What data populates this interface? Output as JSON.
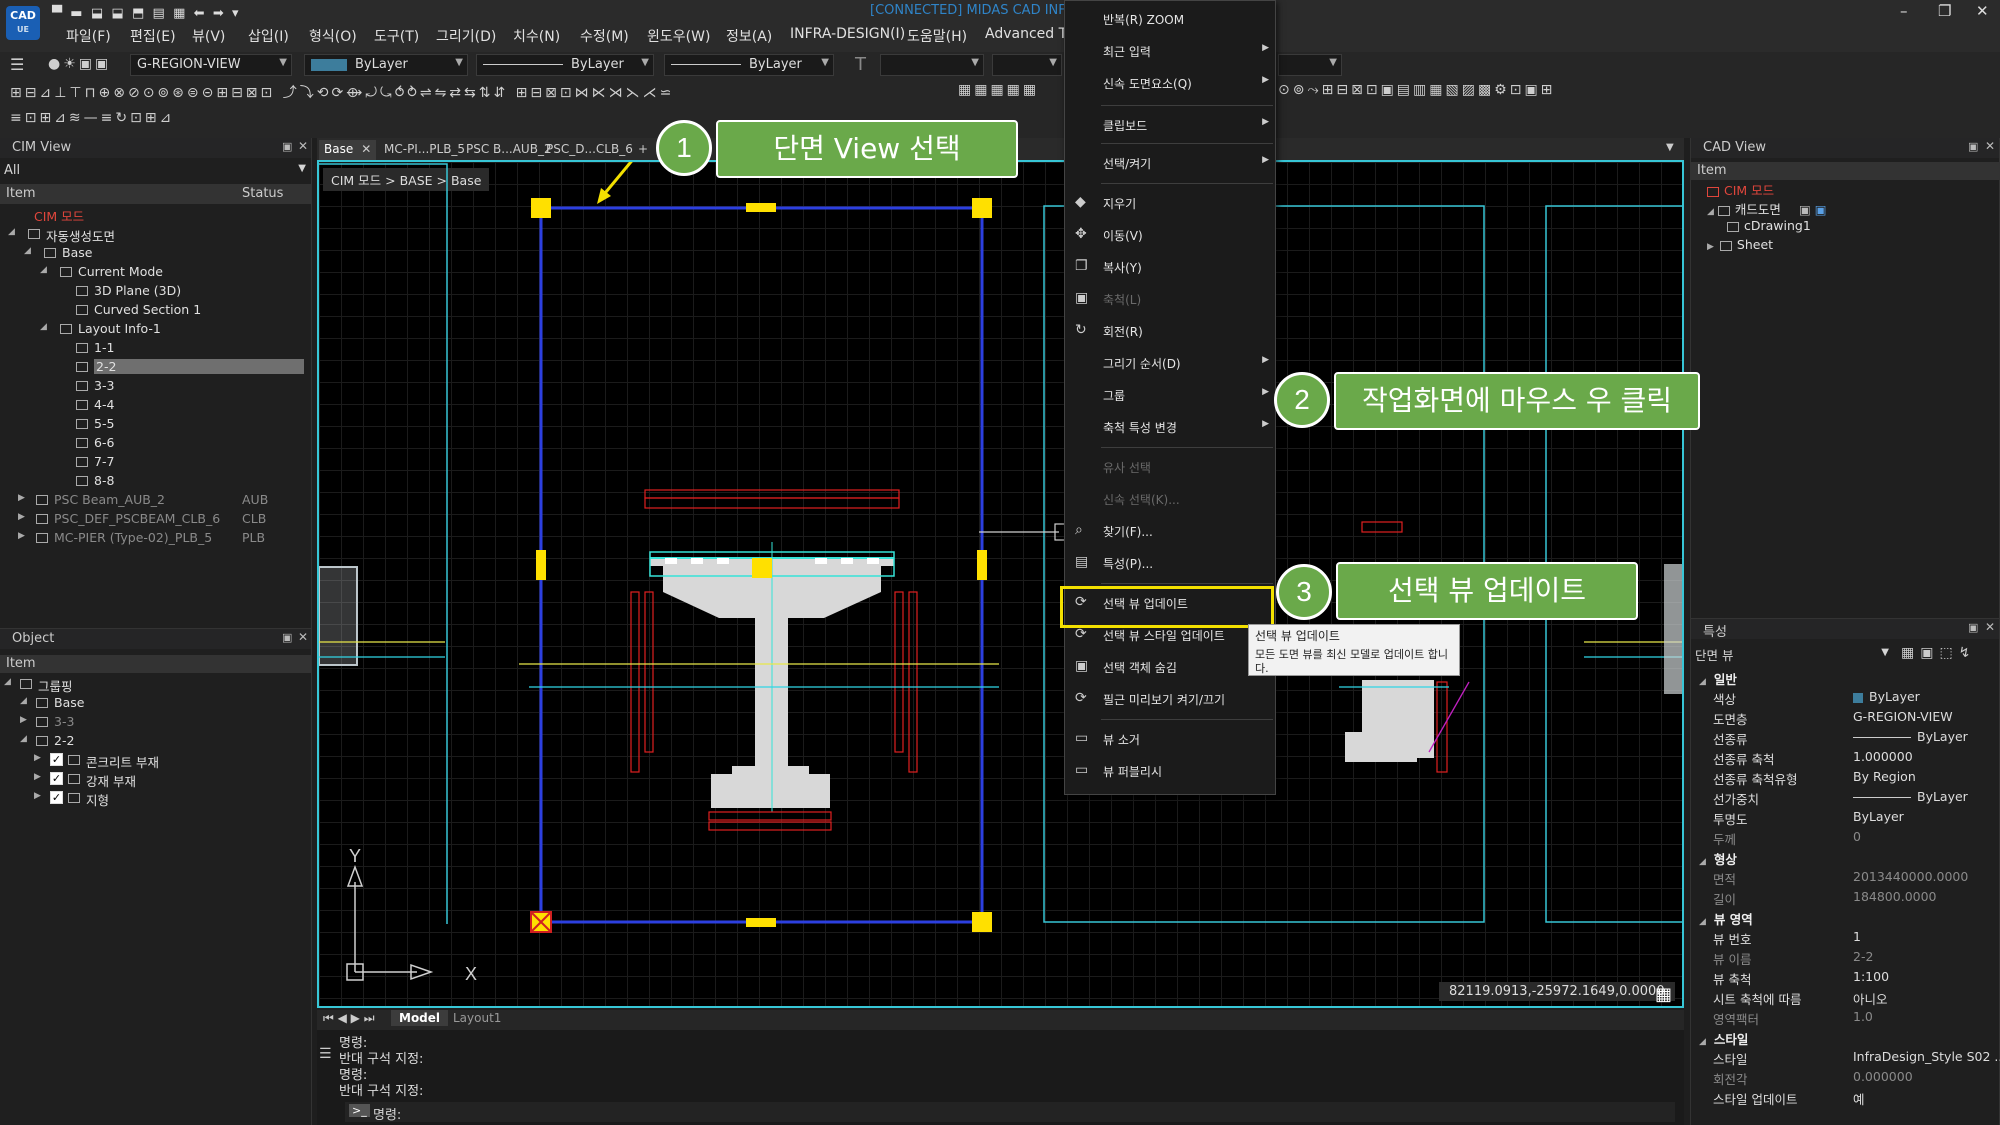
{
  "title_bar": {
    "logo": "CAD",
    "logo_sub": "UE",
    "connection": "[CONNECTED] MIDAS CAD INFRA",
    "menus": [
      "파일(F)",
      "편집(E)",
      "뷰(V)",
      "삽입(I)",
      "형식(O)",
      "도구(T)",
      "그리기(D)",
      "치수(N)",
      "수정(M)",
      "윈도우(W)",
      "정보(A)",
      "INFRA-DESIGN(I)",
      "도움말(H)",
      "Advanced To"
    ],
    "window_controls": [
      "–",
      "❐",
      "✕"
    ]
  },
  "toolbar": {
    "layer_value": "G-REGION-VIEW",
    "color_value": "ByLayer",
    "linetype_value": "ByLayer",
    "lineweight_value": "ByLayer"
  },
  "doc_tabs": [
    "Base",
    "MC-PI...PLB_5",
    "PSC B...AUB_2",
    "PSC_D...CLB_6",
    "+"
  ],
  "breadcrumb": "CIM 모드 > BASE > Base",
  "cim_view": {
    "title": "CIM View",
    "filter": "All",
    "col_item": "Item",
    "col_status": "Status",
    "root": "CIM 모드",
    "rows": [
      {
        "label": "자동생성도면",
        "status": ""
      },
      {
        "label": "Base",
        "status": ""
      },
      {
        "label": "Current Mode",
        "status": ""
      },
      {
        "label": "3D Plane (3D)",
        "status": ""
      },
      {
        "label": "Curved Section 1",
        "status": ""
      },
      {
        "label": "Layout Info-1",
        "status": ""
      },
      {
        "label": "1-1",
        "status": ""
      },
      {
        "label": "2-2",
        "status": ""
      },
      {
        "label": "3-3",
        "status": ""
      },
      {
        "label": "4-4",
        "status": ""
      },
      {
        "label": "5-5",
        "status": ""
      },
      {
        "label": "6-6",
        "status": ""
      },
      {
        "label": "7-7",
        "status": ""
      },
      {
        "label": "8-8",
        "status": ""
      },
      {
        "label": "PSC Beam_AUB_2",
        "status": "AUB"
      },
      {
        "label": "PSC_DEF_PSCBEAM_CLB_6",
        "status": "CLB"
      },
      {
        "label": "MC-PIER (Type-02)_PLB_5",
        "status": "PLB"
      }
    ]
  },
  "object_panel": {
    "title": "Object",
    "col_item": "Item",
    "rows": [
      "그룹핑",
      "Base",
      "3-3",
      "2-2",
      "콘크리트 부재",
      "강재 부재",
      "지형"
    ]
  },
  "cad_view": {
    "title": "CAD View",
    "col_item": "Item",
    "rows": [
      "CIM 모드",
      "캐드도면",
      "cDrawing1",
      "Sheet"
    ]
  },
  "properties": {
    "title": "특성",
    "selector": "단면 뷰",
    "sections": [
      {
        "name": "일반",
        "rows": [
          [
            "색상",
            "ByLayer"
          ],
          [
            "도면층",
            "G-REGION-VIEW"
          ],
          [
            "선종류",
            "ByLayer"
          ],
          [
            "선종류 축척",
            "1.000000"
          ],
          [
            "선종류 축척유형",
            "By Region"
          ],
          [
            "선가중치",
            "ByLayer"
          ],
          [
            "투명도",
            "ByLayer"
          ],
          [
            "두께",
            "0"
          ]
        ]
      },
      {
        "name": "형상",
        "rows": [
          [
            "면적",
            "2013440000.0000"
          ],
          [
            "길이",
            "184800.0000"
          ]
        ]
      },
      {
        "name": "뷰 영역",
        "rows": [
          [
            "뷰 번호",
            "1"
          ],
          [
            "뷰 이름",
            "2-2"
          ],
          [
            "뷰 축척",
            "1:100"
          ],
          [
            "시트 축척에 따름",
            "아니오"
          ],
          [
            "영역팩터",
            "1.0"
          ]
        ]
      },
      {
        "name": "스타일",
        "rows": [
          [
            "스타일",
            "InfraDesign_Style S02 ..."
          ],
          [
            "회전각",
            "0.000000"
          ],
          [
            "스타일 업데이트",
            "예"
          ]
        ]
      }
    ]
  },
  "context_menu": {
    "items": [
      {
        "label": "반복(R) ZOOM",
        "sub": false,
        "disabled": false,
        "icon": ""
      },
      {
        "label": "최근 입력",
        "sub": true,
        "disabled": false,
        "icon": ""
      },
      {
        "label": "신속 도면요소(Q)",
        "sub": true,
        "disabled": false,
        "icon": ""
      },
      {
        "label": "클립보드",
        "sub": true,
        "disabled": false,
        "icon": ""
      },
      {
        "label": "선택/켜기",
        "sub": true,
        "disabled": false,
        "icon": ""
      },
      {
        "label": "지우기",
        "sub": false,
        "disabled": false,
        "icon": "◆"
      },
      {
        "label": "이동(V)",
        "sub": false,
        "disabled": false,
        "icon": "✥"
      },
      {
        "label": "복사(Y)",
        "sub": false,
        "disabled": false,
        "icon": "❐"
      },
      {
        "label": "축척(L)",
        "sub": false,
        "disabled": true,
        "icon": "▣"
      },
      {
        "label": "회전(R)",
        "sub": false,
        "disabled": false,
        "icon": "↻"
      },
      {
        "label": "그리기 순서(D)",
        "sub": true,
        "disabled": false,
        "icon": ""
      },
      {
        "label": "그룹",
        "sub": true,
        "disabled": false,
        "icon": ""
      },
      {
        "label": "축척 특성 변경",
        "sub": true,
        "disabled": false,
        "icon": ""
      },
      {
        "label": "유사 선택",
        "sub": false,
        "disabled": true,
        "icon": ""
      },
      {
        "label": "신속 선택(K)...",
        "sub": false,
        "disabled": true,
        "icon": ""
      },
      {
        "label": "찾기(F)...",
        "sub": false,
        "disabled": false,
        "icon": "⌕"
      },
      {
        "label": "특성(P)...",
        "sub": false,
        "disabled": false,
        "icon": "▤"
      },
      {
        "label": "선택 뷰 업데이트",
        "sub": false,
        "disabled": false,
        "icon": "⟳"
      },
      {
        "label": "선택 뷰 스타일 업데이트",
        "sub": false,
        "disabled": false,
        "icon": "⟳"
      },
      {
        "label": "선택 객체 숨김",
        "sub": false,
        "disabled": false,
        "icon": "▣"
      },
      {
        "label": "필근 미리보기 켜기/끄기",
        "sub": false,
        "disabled": false,
        "icon": "⟳"
      },
      {
        "label": "뷰 소거",
        "sub": false,
        "disabled": false,
        "icon": "▭"
      },
      {
        "label": "뷰 퍼블리시",
        "sub": false,
        "disabled": false,
        "icon": "▭"
      }
    ]
  },
  "tooltip": {
    "title": "선택 뷰 업데이트",
    "body": "모든 도면 뷰를 최신 모델로 업데이트 합니다."
  },
  "callouts": [
    {
      "num": "1",
      "text": "단면 View 선택"
    },
    {
      "num": "2",
      "text": "작업화면에 마우스 우 클릭"
    },
    {
      "num": "3",
      "text": "선택 뷰 업데이트"
    }
  ],
  "status": {
    "coords": "82119.0913,-25972.1649,0.0000",
    "layout_tabs": [
      "Model",
      "Layout1"
    ]
  },
  "command": {
    "lines": [
      "명령:",
      "반대 구석 지정:",
      "명령:",
      "반대 구석 지정:"
    ],
    "prompt": "명령:"
  },
  "colors": {
    "accent_green": "#6aa94a",
    "grip_yellow": "#ffe000",
    "frame_blue": "#2c3fe0",
    "border_cyan": "#37c6d6",
    "dim_red": "#e02020"
  },
  "axis": {
    "x": "X",
    "y": "Y"
  }
}
